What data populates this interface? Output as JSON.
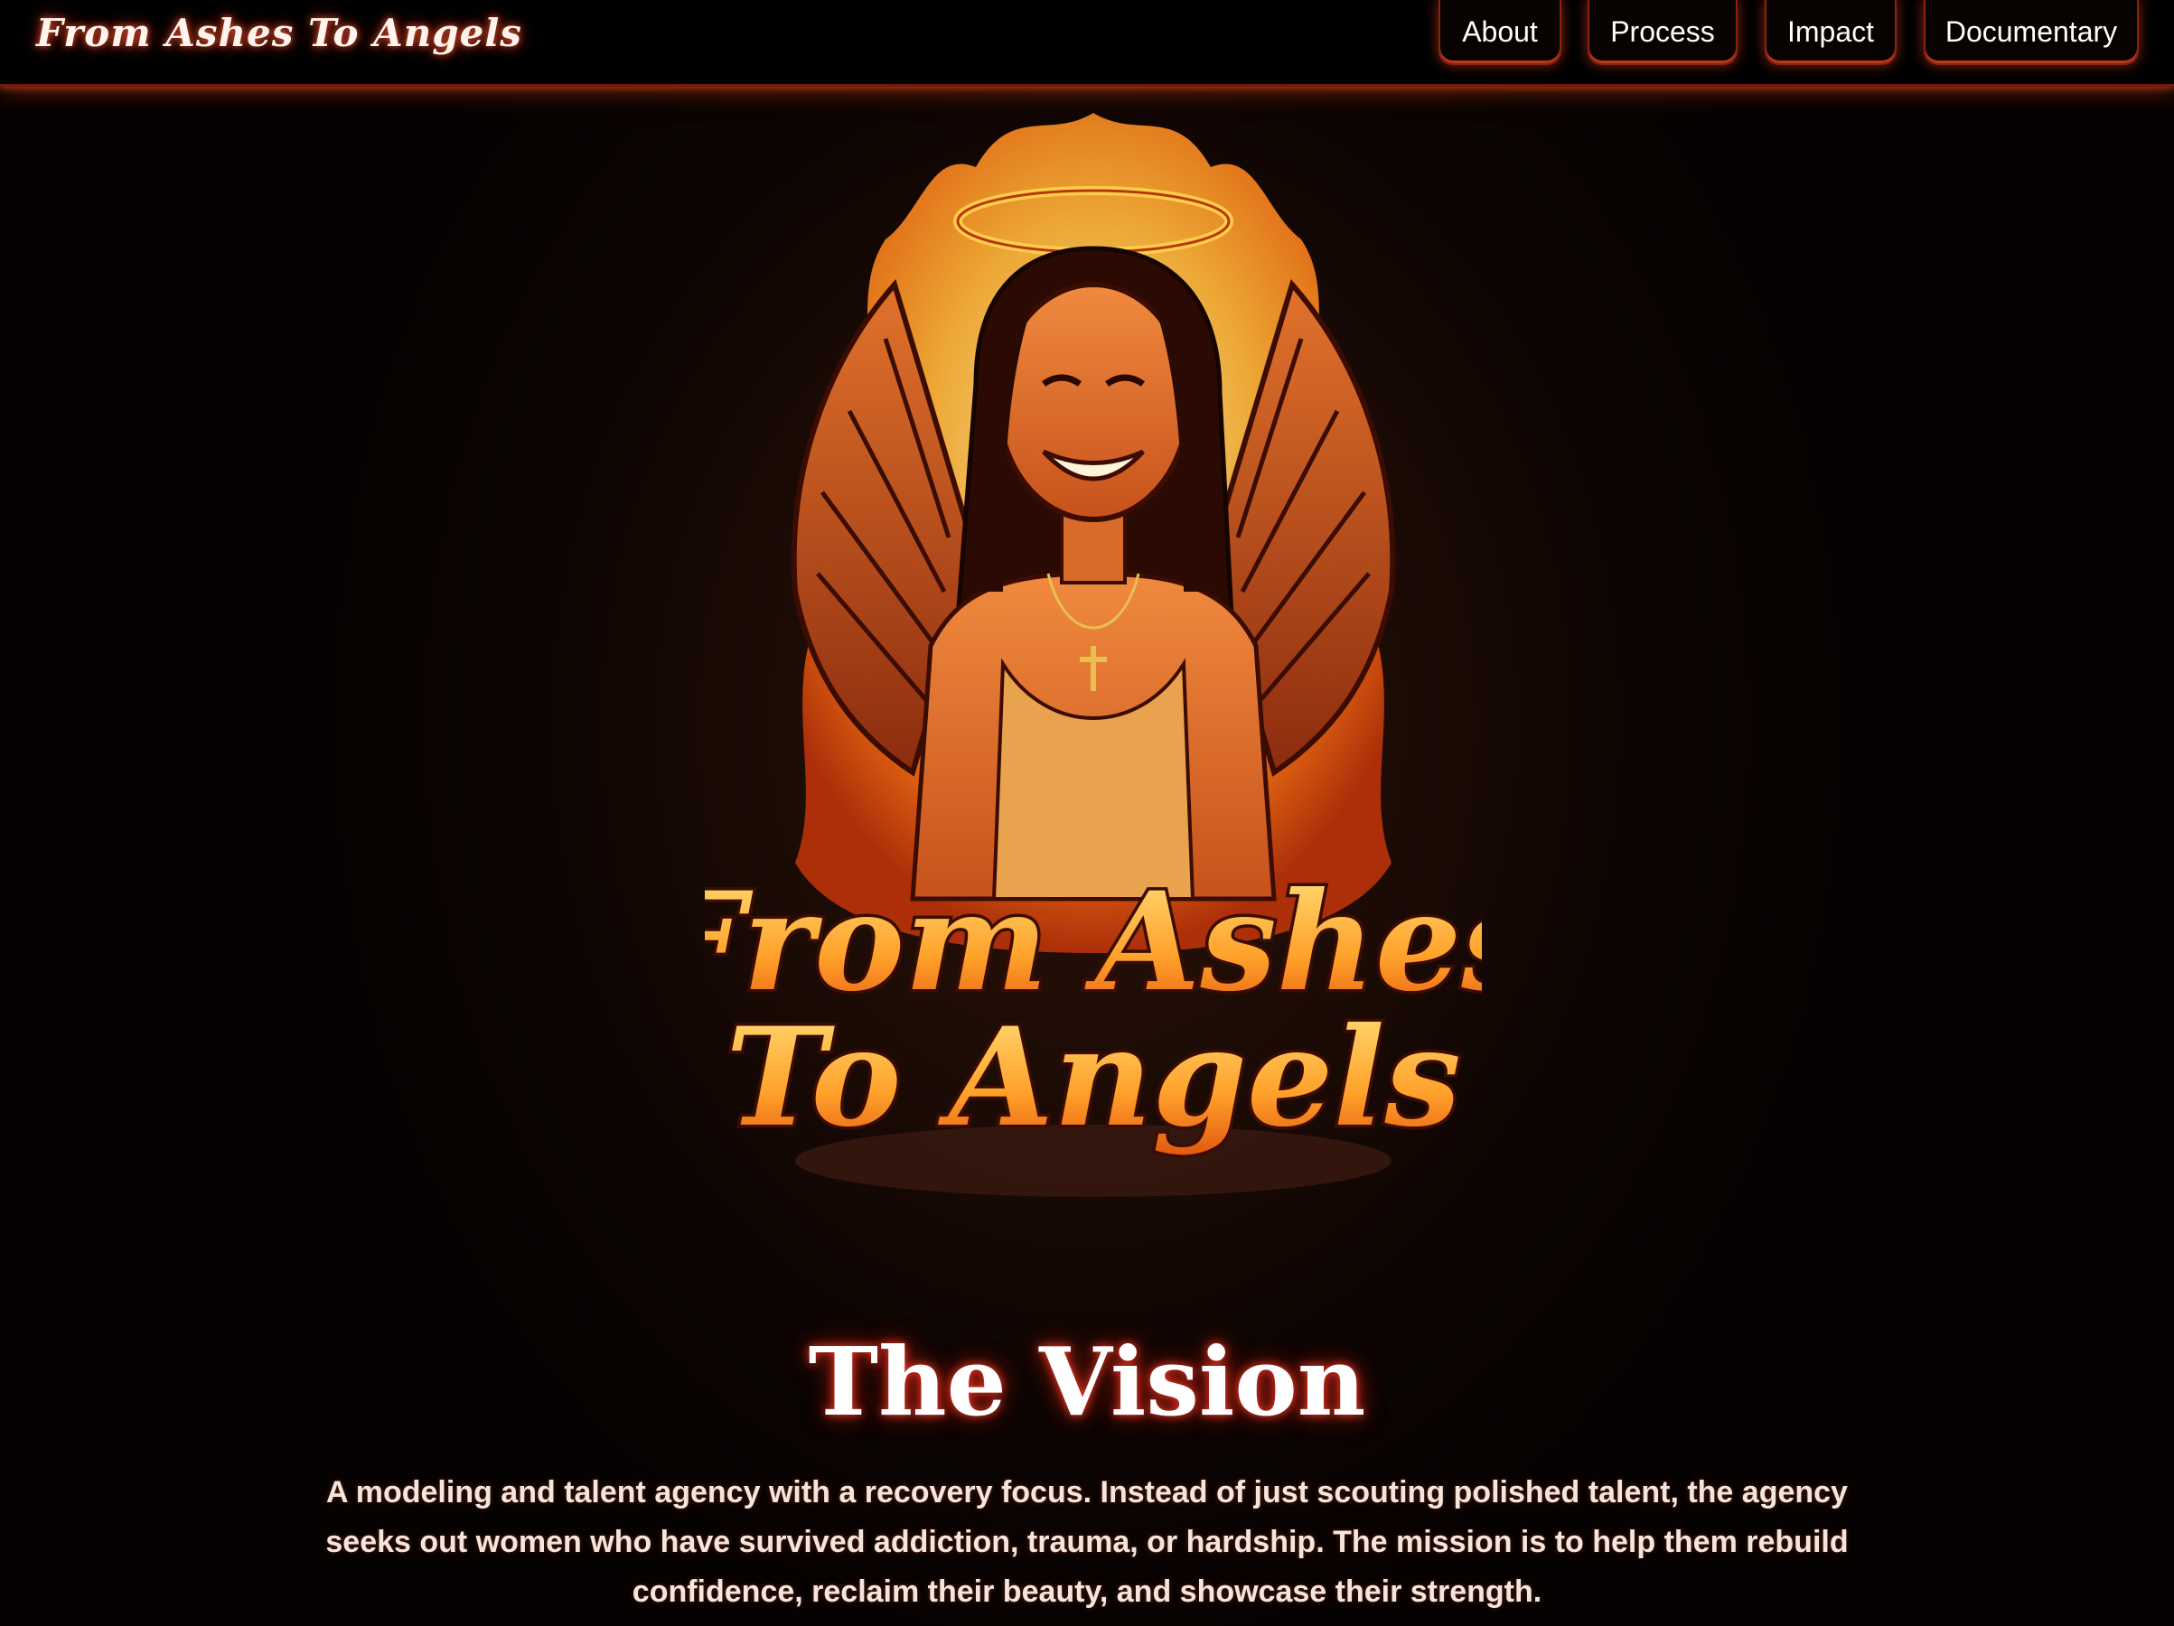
{
  "header": {
    "brand": "From Ashes To Angels",
    "nav": [
      {
        "label": "About"
      },
      {
        "label": "Process"
      },
      {
        "label": "Impact"
      },
      {
        "label": "Documentary"
      }
    ]
  },
  "hero": {
    "art_line1": "From Ashes",
    "art_line2": "To Angels"
  },
  "vision": {
    "title": "The Vision",
    "body": "A modeling and talent agency with a recovery focus. Instead of just scouting polished talent, the agency seeks out women who have survived addiction, trauma, or hardship. The mission is to help them rebuild confidence, reclaim their beauty, and showcase their strength."
  },
  "colors": {
    "accent": "#c0361a",
    "fire": "#ff8a1e",
    "gold": "#ffb03a",
    "background": "#050201"
  }
}
